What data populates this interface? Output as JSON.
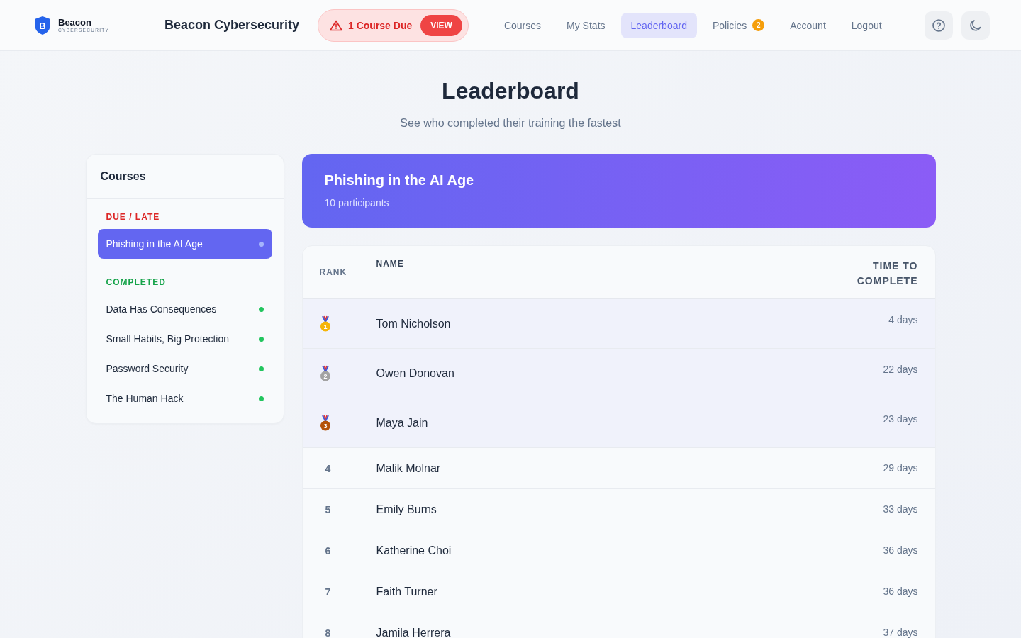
{
  "brand": {
    "name": "Beacon",
    "tagline": "CYBERSECURITY",
    "letter": "B"
  },
  "app_title": "Beacon Cybersecurity",
  "alert": {
    "text": "1 Course Due",
    "button": "VIEW"
  },
  "nav": [
    {
      "label": "Courses",
      "selected": false
    },
    {
      "label": "My Stats",
      "selected": false
    },
    {
      "label": "Leaderboard",
      "selected": true
    },
    {
      "label": "Policies",
      "selected": false,
      "badge": "2"
    },
    {
      "label": "Account",
      "selected": false
    },
    {
      "label": "Logout",
      "selected": false
    }
  ],
  "page": {
    "title": "Leaderboard",
    "subtitle": "See who completed their training the fastest"
  },
  "sidebar": {
    "title": "Courses",
    "groups": [
      {
        "label": "DUE / LATE",
        "color": "#dc2626",
        "items": [
          {
            "label": "Phishing in the AI Age",
            "selected": true,
            "color": "#a5b4fc"
          }
        ]
      },
      {
        "label": "COMPLETED",
        "color": "#16a34a",
        "items": [
          {
            "label": "Data Has Consequences",
            "selected": false,
            "color": "#22c55e"
          },
          {
            "label": "Small Habits, Big Protection",
            "selected": false,
            "color": "#22c55e"
          },
          {
            "label": "Password Security",
            "selected": false,
            "color": "#22c55e"
          },
          {
            "label": "The Human Hack",
            "selected": false,
            "color": "#22c55e"
          }
        ]
      }
    ]
  },
  "course": {
    "title": "Phishing in the AI Age",
    "participants": "10 participants"
  },
  "table": {
    "columns": [
      "RANK",
      "NAME",
      "TIME TO COMPLETE"
    ],
    "rows": [
      {
        "kind": "medal",
        "rank": "1",
        "color": "#f5b50a",
        "name": "Tom Nicholson",
        "time": "4 days"
      },
      {
        "kind": "medal",
        "rank": "2",
        "color": "#a3a3a3",
        "name": "Owen Donovan",
        "time": "22 days"
      },
      {
        "kind": "medal",
        "rank": "3",
        "color": "#b45309",
        "name": "Maya Jain",
        "time": "23 days"
      },
      {
        "kind": "number",
        "rank": "4",
        "name": "Malik Molnar",
        "time": "29 days"
      },
      {
        "kind": "number",
        "rank": "5",
        "name": "Emily Burns",
        "time": "33 days"
      },
      {
        "kind": "number",
        "rank": "6",
        "name": "Katherine Choi",
        "time": "36 days"
      },
      {
        "kind": "number",
        "rank": "7",
        "name": "Faith Turner",
        "time": "36 days"
      },
      {
        "kind": "number",
        "rank": "8",
        "name": "Jamila Herrera",
        "time": "37 days"
      }
    ]
  }
}
